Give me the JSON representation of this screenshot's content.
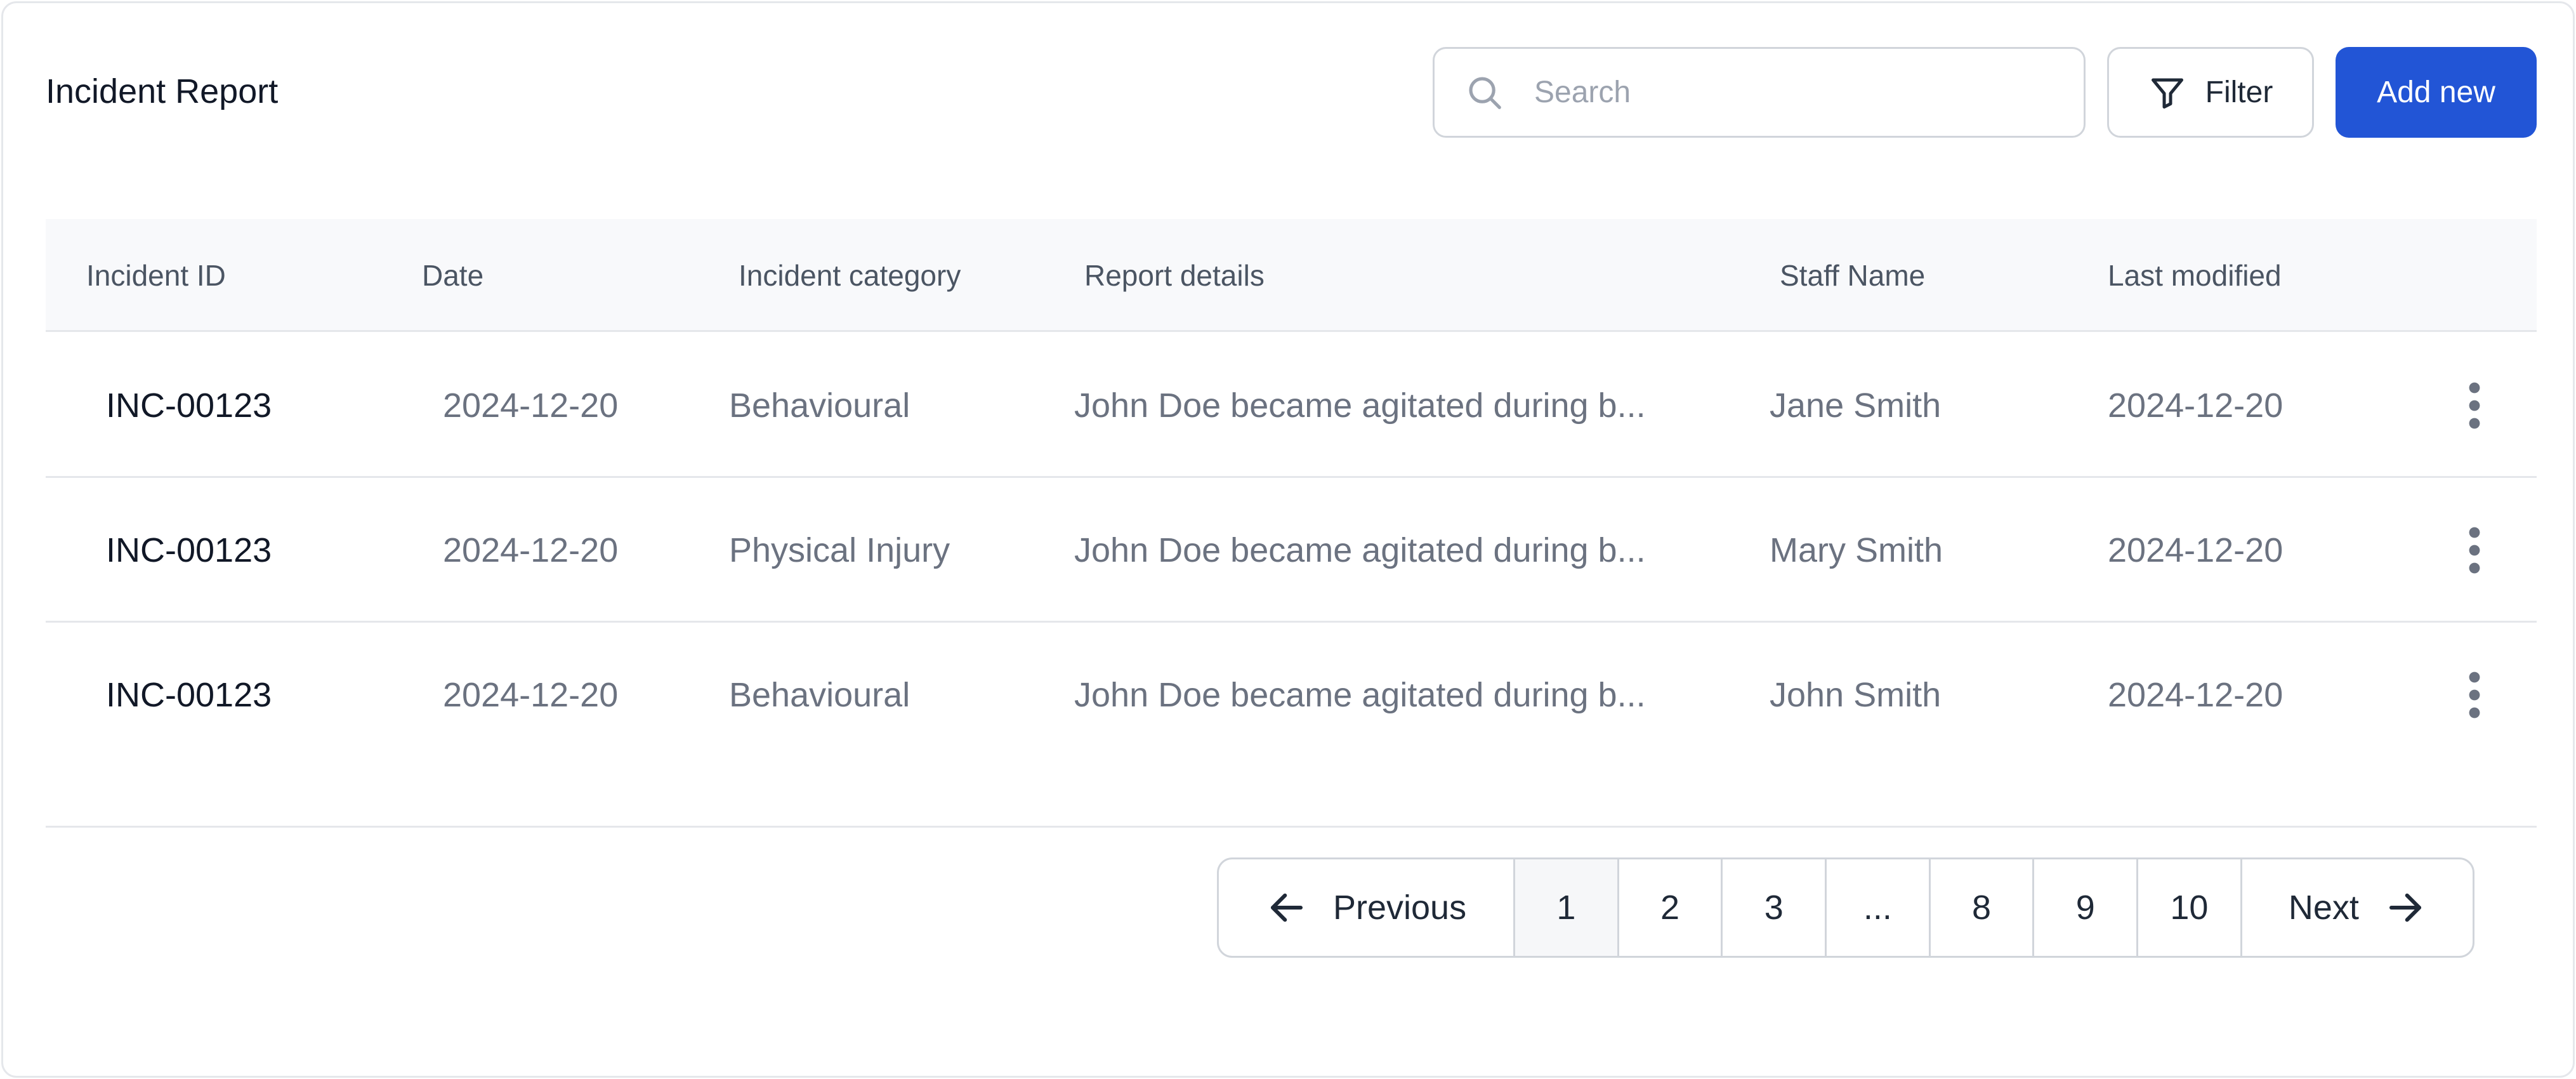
{
  "header": {
    "title": "Incident Report",
    "search_placeholder": "Search",
    "filter_label": "Filter",
    "add_label": "Add new"
  },
  "table": {
    "columns": [
      "Incident ID",
      "Date",
      "Incident category",
      "Report details",
      "Staff Name",
      "Last modified"
    ],
    "rows": [
      {
        "id": "INC-00123",
        "date": "2024-12-20",
        "category": "Behavioural",
        "details": "John Doe became agitated during b...",
        "staff": "Jane Smith",
        "modified": "2024-12-20"
      },
      {
        "id": "INC-00123",
        "date": "2024-12-20",
        "category": "Physical Injury",
        "details": "John Doe became agitated during b...",
        "staff": "Mary Smith",
        "modified": "2024-12-20"
      },
      {
        "id": "INC-00123",
        "date": "2024-12-20",
        "category": "Behavioural",
        "details": "John Doe became agitated during b...",
        "staff": "John Smith",
        "modified": "2024-12-20"
      }
    ]
  },
  "pagination": {
    "previous_label": "Previous",
    "next_label": "Next",
    "pages": [
      "1",
      "2",
      "3",
      "...",
      "8",
      "9",
      "10"
    ],
    "current_page": "1"
  },
  "colors": {
    "accent": "#2255d6",
    "header_bg": "#f8f9fb",
    "border": "#e5e7eb"
  },
  "icons": {
    "search": "search-icon",
    "filter": "filter-icon",
    "row_menu": "more-vertical-icon",
    "prev": "arrow-left-icon",
    "next": "arrow-right-icon"
  }
}
